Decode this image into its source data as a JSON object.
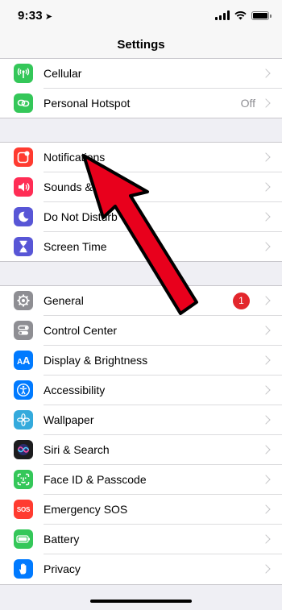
{
  "status_bar": {
    "time": "9:33",
    "location_glyph": "➤"
  },
  "nav": {
    "title": "Settings"
  },
  "rows": [
    {
      "label": "Cellular",
      "icon": "antenna-icon",
      "color": "#34c759"
    },
    {
      "label": "Personal Hotspot",
      "icon": "hotspot-link-icon",
      "color": "#34c759",
      "detail": "Off"
    },
    {
      "label": "Notifications",
      "icon": "notifications-icon",
      "color": "#ff3b30"
    },
    {
      "label": "Sounds & Haptics",
      "icon": "speaker-icon",
      "color": "#ff2d55"
    },
    {
      "label": "Do Not Disturb",
      "icon": "moon-icon",
      "color": "#5856d6"
    },
    {
      "label": "Screen Time",
      "icon": "hourglass-icon",
      "color": "#5856d6"
    },
    {
      "label": "General",
      "icon": "gear-icon",
      "color": "#8e8e93",
      "badge": "1"
    },
    {
      "label": "Control Center",
      "icon": "toggles-icon",
      "color": "#8e8e93"
    },
    {
      "label": "Display & Brightness",
      "icon": "text-size-icon",
      "color": "#007aff"
    },
    {
      "label": "Accessibility",
      "icon": "accessibility-icon",
      "color": "#007aff"
    },
    {
      "label": "Wallpaper",
      "icon": "flower-icon",
      "color": "#34aadc"
    },
    {
      "label": "Siri & Search",
      "icon": "siri-icon",
      "color": "#1c1c1e"
    },
    {
      "label": "Face ID & Passcode",
      "icon": "face-id-icon",
      "color": "#34c759"
    },
    {
      "label": "Emergency SOS",
      "icon": "sos-icon",
      "color": "#ff3b30",
      "icon_text": "SOS"
    },
    {
      "label": "Battery",
      "icon": "battery-icon",
      "color": "#34c759"
    },
    {
      "label": "Privacy",
      "icon": "hand-icon",
      "color": "#007aff"
    }
  ],
  "overlay": {
    "arrow_color": "#e8001c",
    "arrow_icon": "red-pointer-arrow-icon"
  }
}
